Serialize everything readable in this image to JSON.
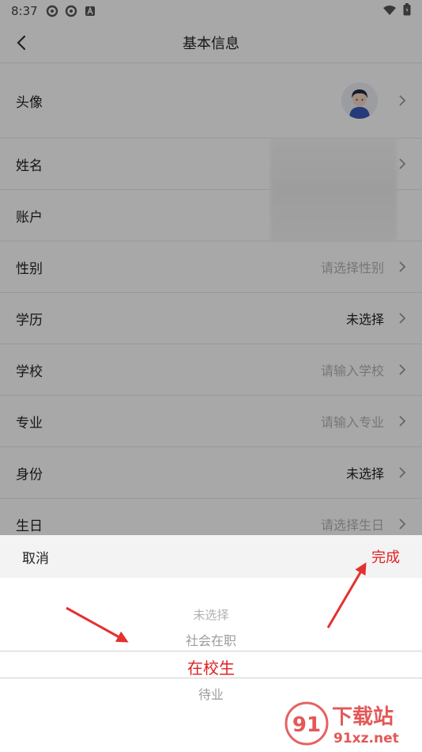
{
  "status_bar": {
    "time": "8:37"
  },
  "header": {
    "title": "基本信息"
  },
  "form": {
    "rows": [
      {
        "label": "头像",
        "value": "",
        "placeholder": false
      },
      {
        "label": "姓名",
        "value": "",
        "placeholder": false
      },
      {
        "label": "账户",
        "value": "",
        "placeholder": false
      },
      {
        "label": "性别",
        "value": "请选择性别",
        "placeholder": true
      },
      {
        "label": "学历",
        "value": "未选择",
        "placeholder": false
      },
      {
        "label": "学校",
        "value": "请输入学校",
        "placeholder": true
      },
      {
        "label": "专业",
        "value": "请输入专业",
        "placeholder": true
      },
      {
        "label": "身份",
        "value": "未选择",
        "placeholder": false
      },
      {
        "label": "生日",
        "value": "请选择生日",
        "placeholder": true
      }
    ]
  },
  "picker": {
    "cancel_label": "取消",
    "done_label": "完成",
    "options": [
      "未选择",
      "社会在职",
      "在校生",
      "待业"
    ],
    "selected": "在校生"
  },
  "watermark": {
    "text": "下载站",
    "sub": "91xz.net",
    "mark": "91"
  },
  "colors": {
    "accent": "#e02020",
    "annotation_arrow": "#e53030"
  }
}
